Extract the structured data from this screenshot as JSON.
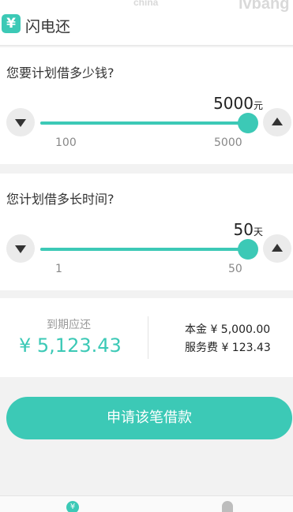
{
  "header": {
    "logo_glyph": "¥",
    "title": "闪电还",
    "watermark_left": "china",
    "watermark_right": "lvbang"
  },
  "amount": {
    "question": "您要计划借多少钱?",
    "value": "5000",
    "unit": "元",
    "min_label": "100",
    "max_label": "5000",
    "min": 100,
    "max": 5000,
    "current": 5000
  },
  "term": {
    "question": "您计划借多长时间?",
    "value": "50",
    "unit": "天",
    "min_label": "1",
    "max_label": "50",
    "min": 1,
    "max": 50,
    "current": 50
  },
  "summary": {
    "due_label": "到期应还",
    "due_amount": "¥ 5,123.43",
    "principal": "本金 ¥ 5,000.00",
    "fee": "服务费 ¥ 123.43"
  },
  "apply_button": "申请该笔借款",
  "tabbar": {
    "home_glyph": "¥"
  },
  "colors": {
    "accent": "#3cc9b6",
    "track": "#dcdcdc",
    "background": "#f2f2f2"
  }
}
